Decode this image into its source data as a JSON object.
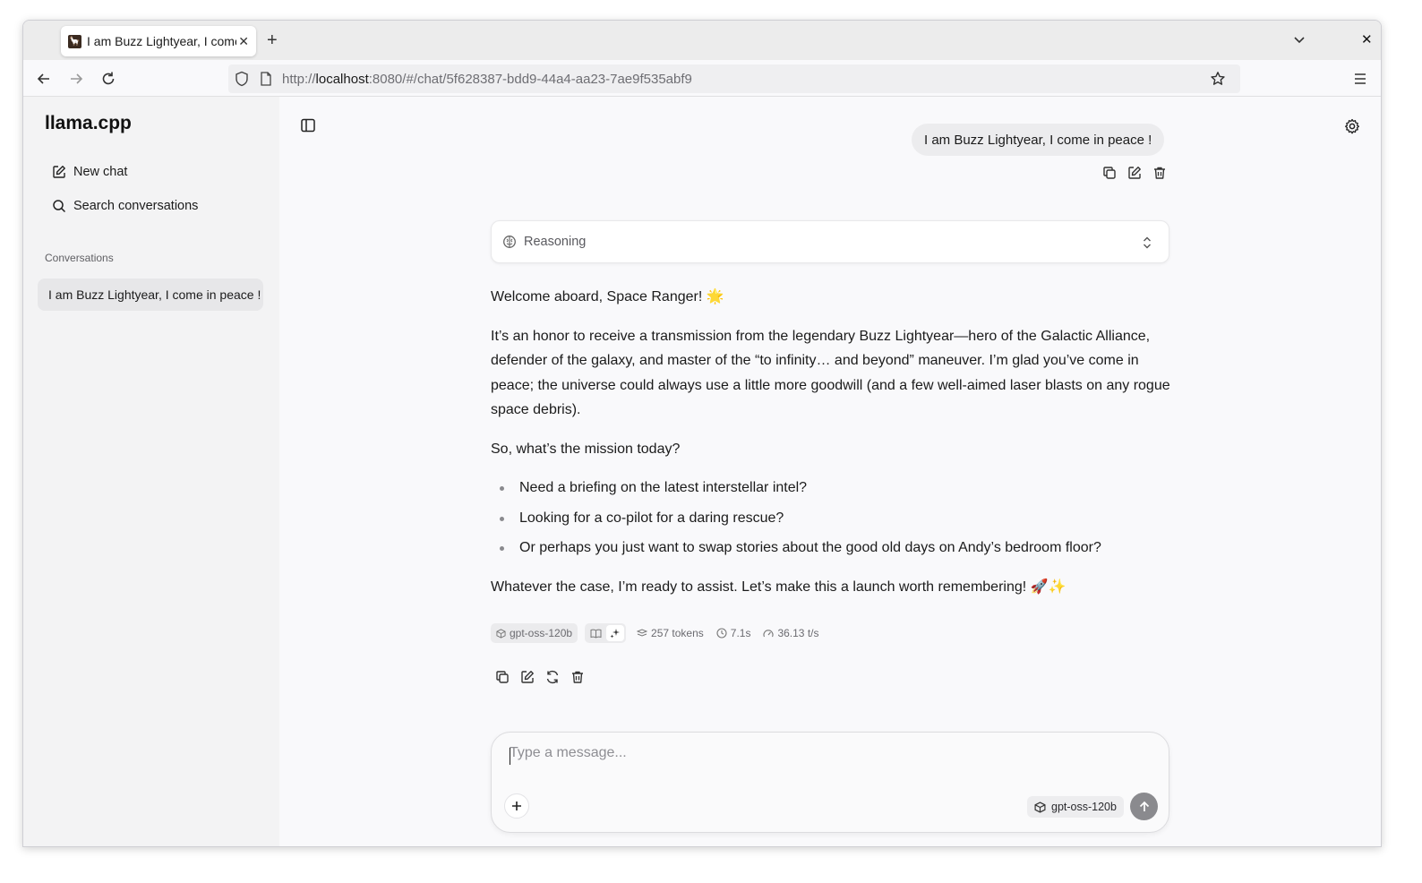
{
  "browser": {
    "tab_title": "I am Buzz Lightyear, I come in peace !",
    "favicon_glyph": "🦙",
    "url_prefix": "http://",
    "url_host": "localhost",
    "url_rest": ":8080/#/chat/5f628387-bdd9-44a4-aa23-7ae9f535abf9"
  },
  "sidebar": {
    "brand": "llama.cpp",
    "new_chat": "New chat",
    "search": "Search conversations",
    "conversations_label": "Conversations",
    "conversations": [
      "I am Buzz Lightyear, I come in peace !"
    ]
  },
  "chat": {
    "user_message": "I am Buzz Lightyear, I come in peace !",
    "reasoning_label": "Reasoning",
    "answer": {
      "p1": "Welcome aboard, Space Ranger! 🌟",
      "p2": "It’s an honor to receive a transmission from the legendary Buzz Lightyear—hero of the Galactic Alliance, defender of the galaxy, and master of the “to infinity… and beyond” maneuver. I’m glad you’ve come in peace; the universe could always use a little more goodwill (and a few well‑aimed laser blasts on any rogue space debris).",
      "p3": "So, what’s the mission today?",
      "bullets": [
        "Need a briefing on the latest interstellar intel?",
        "Looking for a co-pilot for a daring rescue?",
        "Or perhaps you just want to swap stories about the good old days on Andy’s bedroom floor?"
      ],
      "p4": "Whatever the case, I’m ready to assist. Let’s make this a launch worth remembering! 🚀✨"
    },
    "stats": {
      "model": "gpt-oss-120b",
      "tokens": "257 tokens",
      "time": "7.1s",
      "speed": "36.13 t/s"
    }
  },
  "composer": {
    "placeholder": "Type a message...",
    "model": "gpt-oss-120b"
  }
}
